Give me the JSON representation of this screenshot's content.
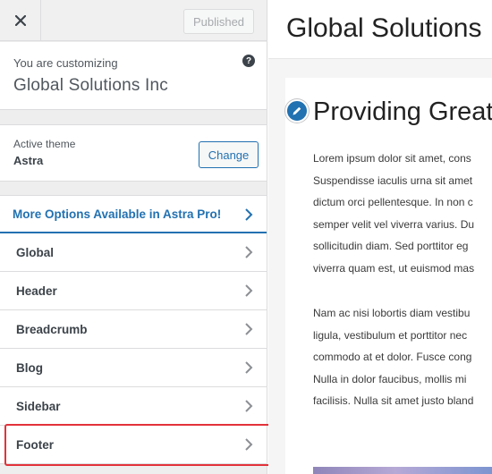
{
  "sidebar": {
    "close_label": "×",
    "published_label": "Published",
    "customizing_label": "You are customizing",
    "site_name": "Global Solutions Inc",
    "help_label": "?",
    "active_theme_label": "Active theme",
    "theme_name": "Astra",
    "change_label": "Change",
    "promo_label": "More Options Available in Astra Pro!",
    "items": [
      {
        "label": "Global"
      },
      {
        "label": "Header"
      },
      {
        "label": "Breadcrumb"
      },
      {
        "label": "Blog"
      },
      {
        "label": "Sidebar"
      },
      {
        "label": "Footer"
      }
    ],
    "highlighted_item": "Footer"
  },
  "preview": {
    "site_title": "Global Solutions",
    "post_title": "Providing Great",
    "paragraph1": [
      "Lorem ipsum dolor sit amet, cons",
      "Suspendisse iaculis urna sit amet",
      "dictum orci pellentesque. In non c",
      "semper velit vel viverra varius. Du",
      "sollicitudin diam. Sed porttitor eg",
      "viverra quam est, ut euismod mas"
    ],
    "paragraph2": [
      "Nam ac nisi lobortis diam vestibu",
      "ligula, vestibulum et porttitor nec",
      "commodo at et dolor. Fusce cong",
      "Nulla in dolor faucibus, mollis mi",
      "facilisis. Nulla sit amet justo bland"
    ]
  },
  "colors": {
    "accent": "#2271b1",
    "highlight": "#e2323a",
    "sidebar_bg": "#eeeeee"
  },
  "icons": {
    "close": "close-icon",
    "help": "help-icon",
    "chevron": "chevron-right-icon",
    "edit": "pencil-icon"
  }
}
